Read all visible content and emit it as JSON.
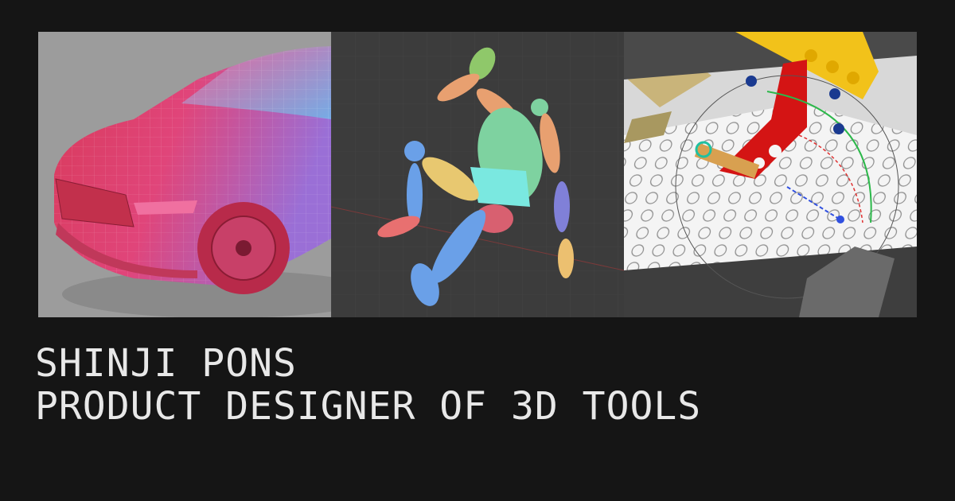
{
  "header": {
    "name": "SHINJI PONS",
    "role": "PRODUCT DESIGNER OF 3D TOOLS"
  },
  "panels": [
    {
      "subject": "car-wireframe-render"
    },
    {
      "subject": "posed-mannequin-rig"
    },
    {
      "subject": "brick-model-transform-gizmo"
    }
  ],
  "colors": {
    "background": "#151515",
    "text": "#e8e8e8"
  }
}
